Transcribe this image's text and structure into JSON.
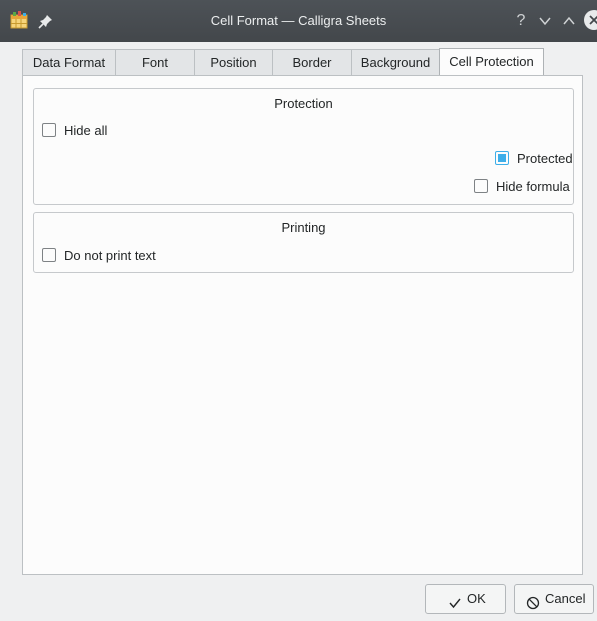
{
  "window": {
    "title": "Cell Format — Calligra Sheets",
    "help_glyph": "?",
    "icons": [
      "app-icon",
      "pin-icon",
      "help-icon",
      "minimize-icon",
      "maximize-icon",
      "close-icon"
    ]
  },
  "tabs": [
    {
      "label": "Data Format",
      "active": false
    },
    {
      "label": "Font",
      "active": false
    },
    {
      "label": "Position",
      "active": false
    },
    {
      "label": "Border",
      "active": false
    },
    {
      "label": "Background",
      "active": false
    },
    {
      "label": "Cell Protection",
      "active": true
    }
  ],
  "protection": {
    "title": "Protection",
    "hide_all": {
      "label": "Hide all",
      "checked": false
    },
    "protected": {
      "label": "Protected",
      "checked": true
    },
    "hide_formula": {
      "label": "Hide formula",
      "checked": false
    }
  },
  "printing": {
    "title": "Printing",
    "do_not_print": {
      "label": "Do not print text",
      "checked": false
    }
  },
  "buttons": {
    "ok": "OK",
    "cancel": "Cancel"
  },
  "colors": {
    "accent": "#3daee9",
    "titlebar": "#475057",
    "background": "#eff0f1"
  }
}
